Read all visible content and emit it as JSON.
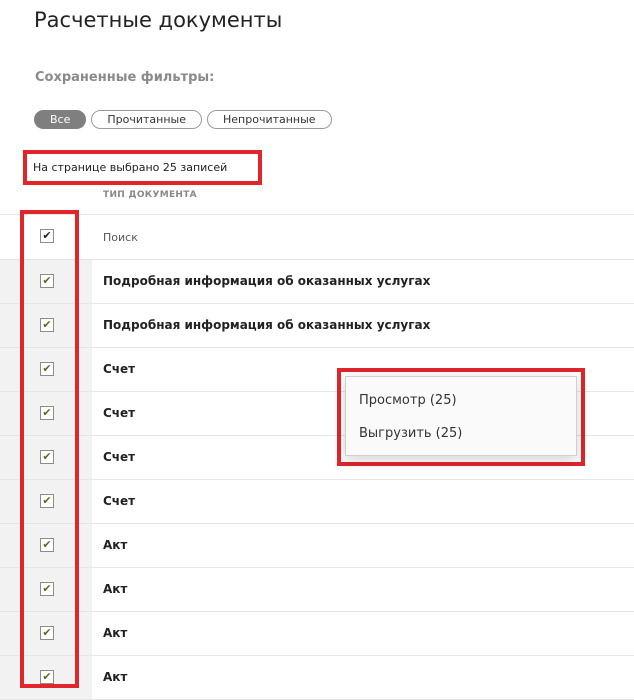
{
  "page": {
    "title": "Расчетные документы"
  },
  "filters": {
    "label": "Сохраненные фильтры:",
    "items": [
      {
        "label": "Все",
        "active": true
      },
      {
        "label": "Прочитанные",
        "active": false
      },
      {
        "label": "Непрочитанные",
        "active": false
      }
    ]
  },
  "selection": {
    "info": "На странице выбрано 25 записей"
  },
  "table": {
    "column_header": "ТИП ДОКУМЕНТА",
    "search_placeholder": "Поиск",
    "rows": [
      {
        "doc_type": "Подробная информация об оказанных услугах",
        "checked": true
      },
      {
        "doc_type": "Подробная информация об оказанных услугах",
        "checked": true
      },
      {
        "doc_type": "Счет",
        "checked": true
      },
      {
        "doc_type": "Счет",
        "checked": true
      },
      {
        "doc_type": "Счет",
        "checked": true
      },
      {
        "doc_type": "Счет",
        "checked": true
      },
      {
        "doc_type": "Акт",
        "checked": true
      },
      {
        "doc_type": "Акт",
        "checked": true
      },
      {
        "doc_type": "Акт",
        "checked": true
      },
      {
        "doc_type": "Акт",
        "checked": true
      }
    ]
  },
  "context_menu": {
    "items": [
      {
        "label": "Просмотр (25)"
      },
      {
        "label": "Выгрузить (25)"
      }
    ]
  },
  "icons": {
    "checkmark": "✔"
  },
  "colors": {
    "highlight": "#e0252b",
    "check": "#5c6e1b",
    "active_filter": "#7f7f7f"
  }
}
